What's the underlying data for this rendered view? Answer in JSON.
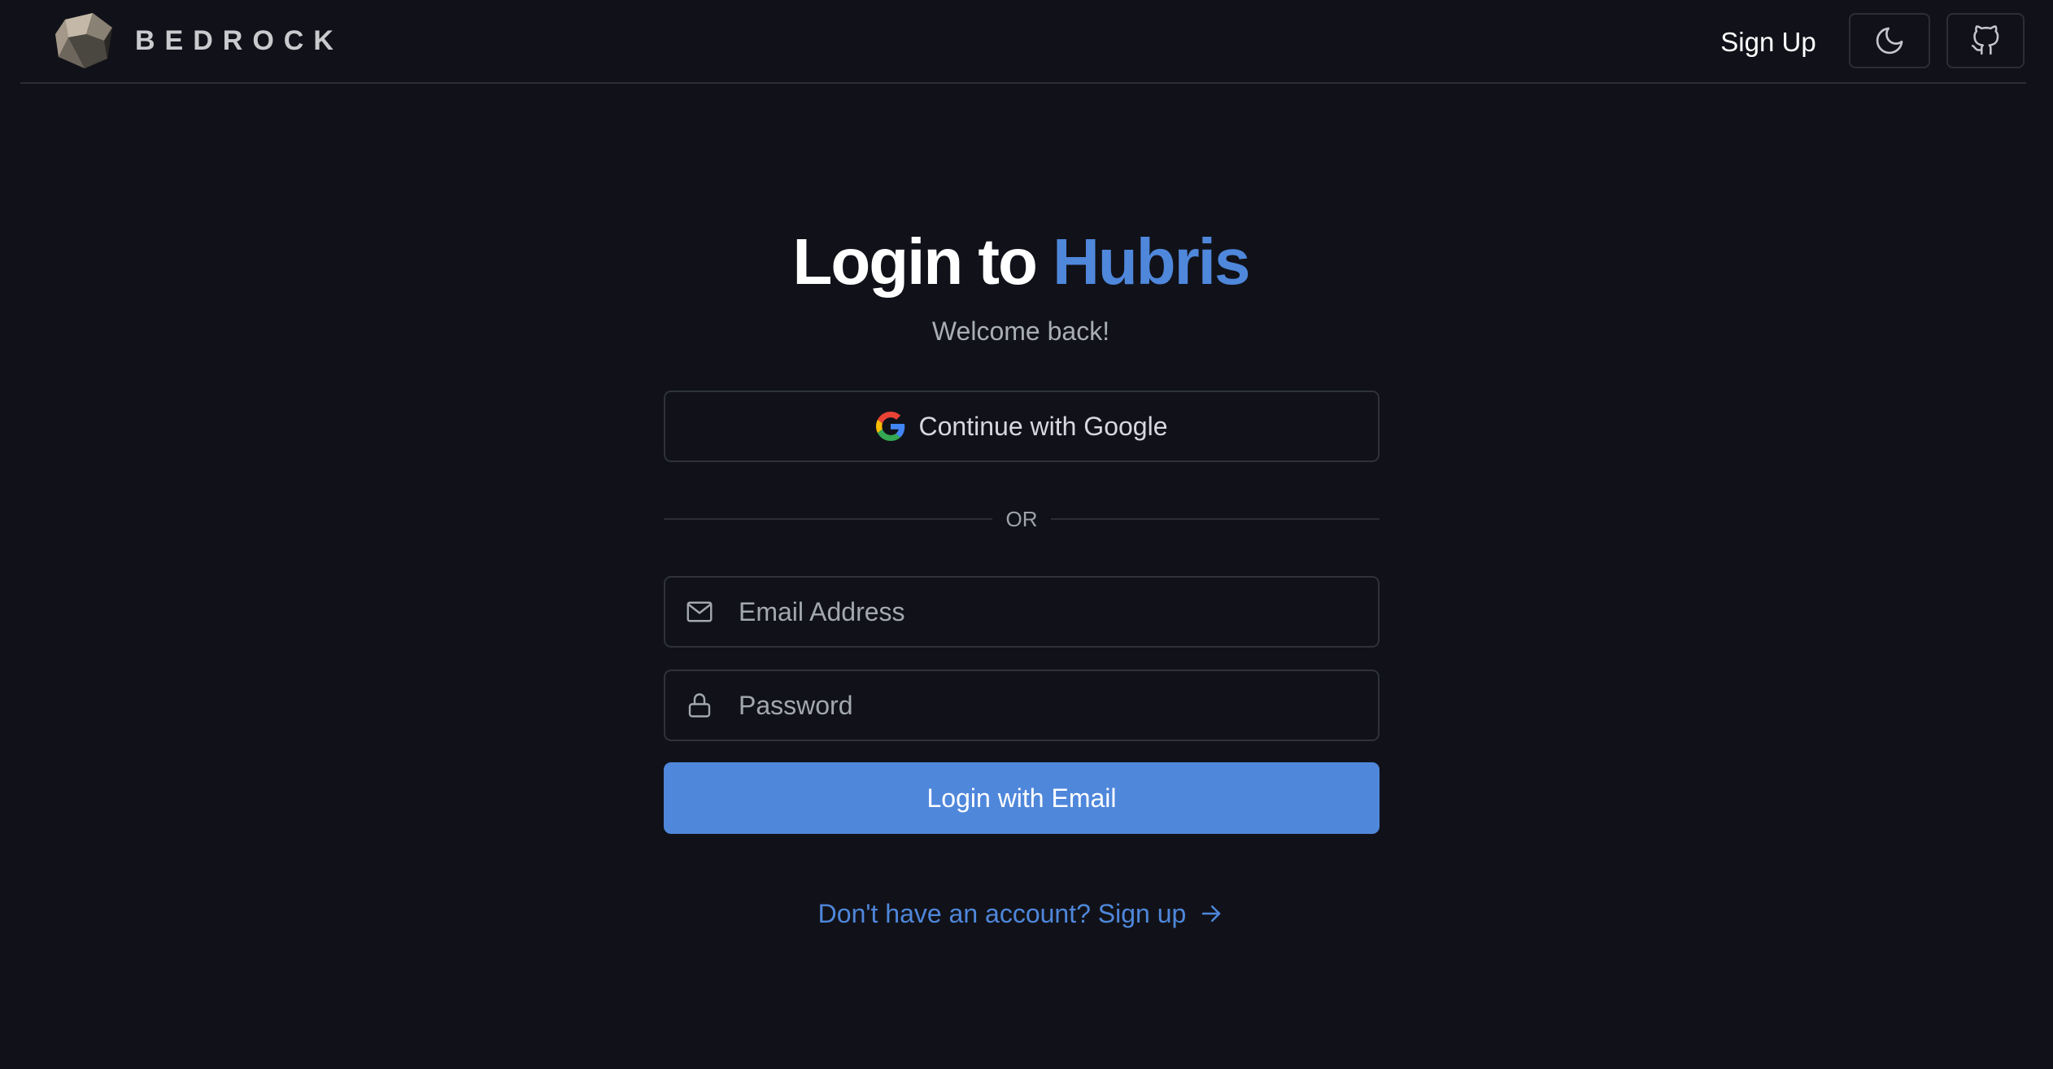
{
  "header": {
    "brand_name": "BEDROCK",
    "signup_label": "Sign Up",
    "theme_toggle_icon": "moon-icon",
    "github_icon": "github-icon"
  },
  "login": {
    "title_prefix": "Login to",
    "title_accent": "Hubris",
    "subtitle": "Welcome back!",
    "google_button_label": "Continue with Google",
    "divider_text": "OR",
    "email_placeholder": "Email Address",
    "email_icon": "mail-icon",
    "password_placeholder": "Password",
    "password_icon": "lock-icon",
    "submit_label": "Login with Email",
    "signup_prompt": "Don't have an account? Sign up",
    "signup_arrow_icon": "arrow-right-icon"
  },
  "colors": {
    "background": "#111219",
    "accent": "#4f87db",
    "border": "#2f3239",
    "muted_text": "#a9adb6"
  }
}
